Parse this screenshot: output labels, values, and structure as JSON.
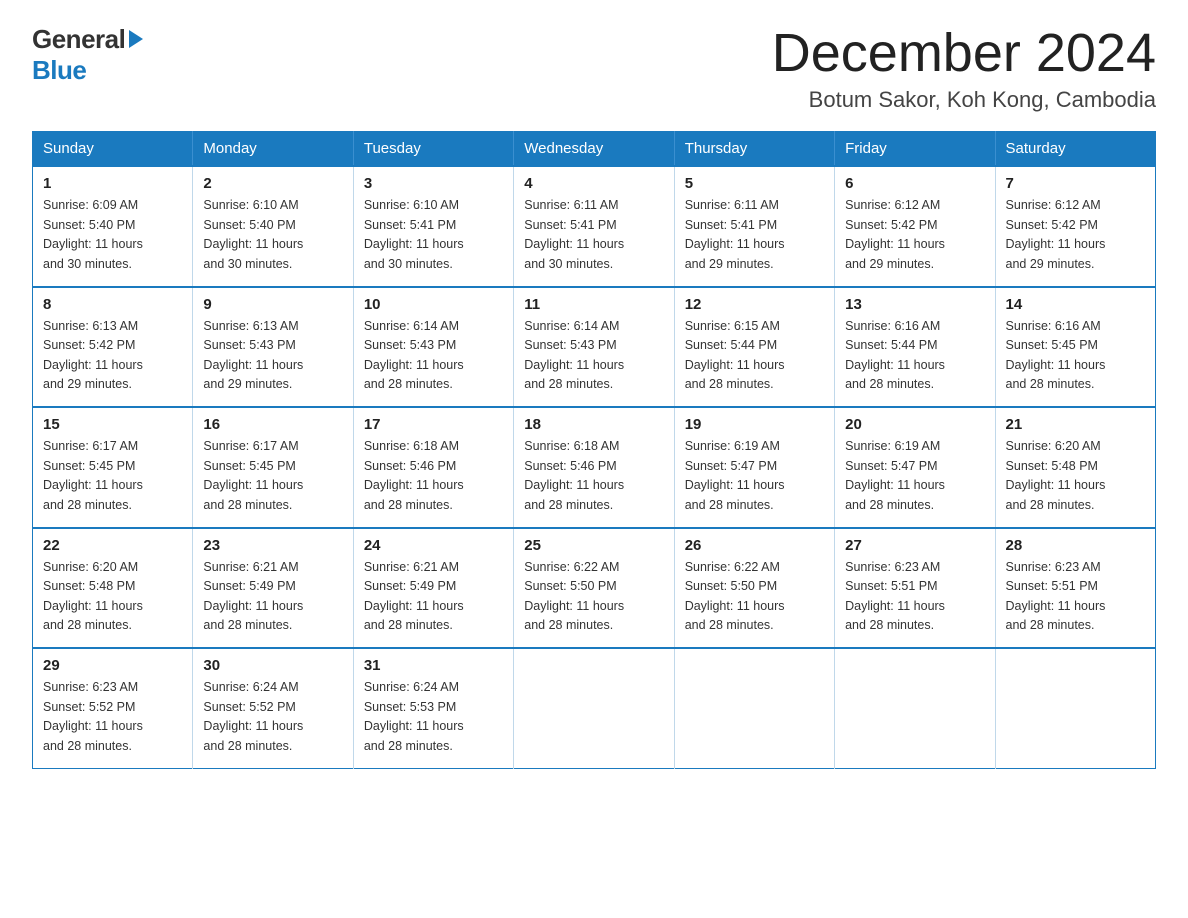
{
  "logo": {
    "general": "General",
    "blue": "Blue"
  },
  "header": {
    "month": "December 2024",
    "location": "Botum Sakor, Koh Kong, Cambodia"
  },
  "weekdays": [
    "Sunday",
    "Monday",
    "Tuesday",
    "Wednesday",
    "Thursday",
    "Friday",
    "Saturday"
  ],
  "weeks": [
    [
      {
        "day": "1",
        "sunrise": "6:09 AM",
        "sunset": "5:40 PM",
        "daylight": "11 hours and 30 minutes."
      },
      {
        "day": "2",
        "sunrise": "6:10 AM",
        "sunset": "5:40 PM",
        "daylight": "11 hours and 30 minutes."
      },
      {
        "day": "3",
        "sunrise": "6:10 AM",
        "sunset": "5:41 PM",
        "daylight": "11 hours and 30 minutes."
      },
      {
        "day": "4",
        "sunrise": "6:11 AM",
        "sunset": "5:41 PM",
        "daylight": "11 hours and 30 minutes."
      },
      {
        "day": "5",
        "sunrise": "6:11 AM",
        "sunset": "5:41 PM",
        "daylight": "11 hours and 29 minutes."
      },
      {
        "day": "6",
        "sunrise": "6:12 AM",
        "sunset": "5:42 PM",
        "daylight": "11 hours and 29 minutes."
      },
      {
        "day": "7",
        "sunrise": "6:12 AM",
        "sunset": "5:42 PM",
        "daylight": "11 hours and 29 minutes."
      }
    ],
    [
      {
        "day": "8",
        "sunrise": "6:13 AM",
        "sunset": "5:42 PM",
        "daylight": "11 hours and 29 minutes."
      },
      {
        "day": "9",
        "sunrise": "6:13 AM",
        "sunset": "5:43 PM",
        "daylight": "11 hours and 29 minutes."
      },
      {
        "day": "10",
        "sunrise": "6:14 AM",
        "sunset": "5:43 PM",
        "daylight": "11 hours and 28 minutes."
      },
      {
        "day": "11",
        "sunrise": "6:14 AM",
        "sunset": "5:43 PM",
        "daylight": "11 hours and 28 minutes."
      },
      {
        "day": "12",
        "sunrise": "6:15 AM",
        "sunset": "5:44 PM",
        "daylight": "11 hours and 28 minutes."
      },
      {
        "day": "13",
        "sunrise": "6:16 AM",
        "sunset": "5:44 PM",
        "daylight": "11 hours and 28 minutes."
      },
      {
        "day": "14",
        "sunrise": "6:16 AM",
        "sunset": "5:45 PM",
        "daylight": "11 hours and 28 minutes."
      }
    ],
    [
      {
        "day": "15",
        "sunrise": "6:17 AM",
        "sunset": "5:45 PM",
        "daylight": "11 hours and 28 minutes."
      },
      {
        "day": "16",
        "sunrise": "6:17 AM",
        "sunset": "5:45 PM",
        "daylight": "11 hours and 28 minutes."
      },
      {
        "day": "17",
        "sunrise": "6:18 AM",
        "sunset": "5:46 PM",
        "daylight": "11 hours and 28 minutes."
      },
      {
        "day": "18",
        "sunrise": "6:18 AM",
        "sunset": "5:46 PM",
        "daylight": "11 hours and 28 minutes."
      },
      {
        "day": "19",
        "sunrise": "6:19 AM",
        "sunset": "5:47 PM",
        "daylight": "11 hours and 28 minutes."
      },
      {
        "day": "20",
        "sunrise": "6:19 AM",
        "sunset": "5:47 PM",
        "daylight": "11 hours and 28 minutes."
      },
      {
        "day": "21",
        "sunrise": "6:20 AM",
        "sunset": "5:48 PM",
        "daylight": "11 hours and 28 minutes."
      }
    ],
    [
      {
        "day": "22",
        "sunrise": "6:20 AM",
        "sunset": "5:48 PM",
        "daylight": "11 hours and 28 minutes."
      },
      {
        "day": "23",
        "sunrise": "6:21 AM",
        "sunset": "5:49 PM",
        "daylight": "11 hours and 28 minutes."
      },
      {
        "day": "24",
        "sunrise": "6:21 AM",
        "sunset": "5:49 PM",
        "daylight": "11 hours and 28 minutes."
      },
      {
        "day": "25",
        "sunrise": "6:22 AM",
        "sunset": "5:50 PM",
        "daylight": "11 hours and 28 minutes."
      },
      {
        "day": "26",
        "sunrise": "6:22 AM",
        "sunset": "5:50 PM",
        "daylight": "11 hours and 28 minutes."
      },
      {
        "day": "27",
        "sunrise": "6:23 AM",
        "sunset": "5:51 PM",
        "daylight": "11 hours and 28 minutes."
      },
      {
        "day": "28",
        "sunrise": "6:23 AM",
        "sunset": "5:51 PM",
        "daylight": "11 hours and 28 minutes."
      }
    ],
    [
      {
        "day": "29",
        "sunrise": "6:23 AM",
        "sunset": "5:52 PM",
        "daylight": "11 hours and 28 minutes."
      },
      {
        "day": "30",
        "sunrise": "6:24 AM",
        "sunset": "5:52 PM",
        "daylight": "11 hours and 28 minutes."
      },
      {
        "day": "31",
        "sunrise": "6:24 AM",
        "sunset": "5:53 PM",
        "daylight": "11 hours and 28 minutes."
      },
      null,
      null,
      null,
      null
    ]
  ],
  "labels": {
    "sunrise": "Sunrise:",
    "sunset": "Sunset:",
    "daylight": "Daylight:"
  }
}
